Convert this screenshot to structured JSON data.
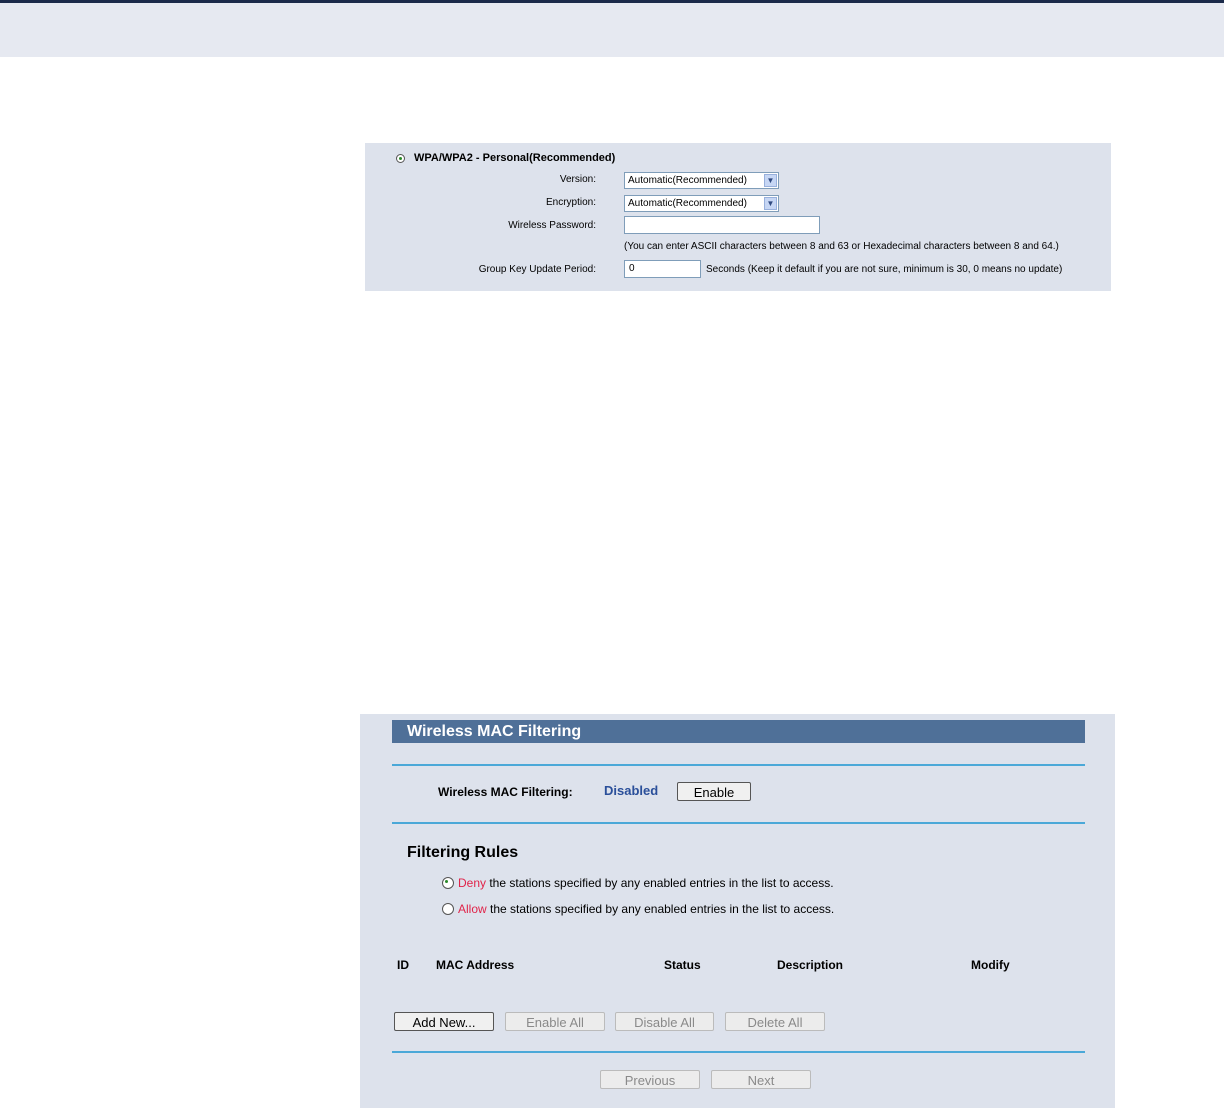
{
  "wpa": {
    "title": "WPA/WPA2 - Personal(Recommended)",
    "version_label": "Version:",
    "version_value": "Automatic(Recommended)",
    "encryption_label": "Encryption:",
    "encryption_value": "Automatic(Recommended)",
    "password_label": "Wireless Password:",
    "password_value": "",
    "password_hint": "(You can enter ASCII characters between 8 and 63 or Hexadecimal characters between 8 and 64.)",
    "group_key_label": "Group Key Update Period:",
    "group_key_value": "0",
    "group_key_hint": "Seconds (Keep it default if you are not sure, minimum is 30, 0 means no update)"
  },
  "mac": {
    "title": "Wireless MAC Filtering",
    "filter_label": "Wireless MAC Filtering:",
    "filter_status": "Disabled",
    "enable_button": "Enable",
    "rules_heading": "Filtering Rules",
    "deny_word": "Deny",
    "deny_rest": " the stations specified by any enabled entries in the list to access.",
    "allow_word": "Allow",
    "allow_rest": " the stations specified by any enabled entries in the list to access.",
    "columns": [
      "ID",
      "MAC Address",
      "Status",
      "Description",
      "Modify"
    ],
    "buttons": {
      "add_new": "Add New...",
      "enable_all": "Enable All",
      "disable_all": "Disable All",
      "delete_all": "Delete All",
      "previous": "Previous",
      "next": "Next"
    }
  },
  "colors": {
    "header_bar": "#4f7098",
    "panel_bg": "#dde2ec",
    "divider": "#4aa8d8",
    "status_text": "#2a4f9a",
    "rule_word": "#e0244a"
  }
}
